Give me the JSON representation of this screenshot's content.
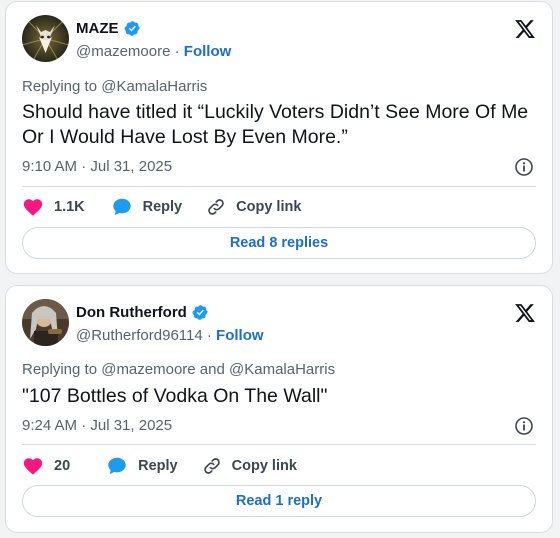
{
  "tweets": [
    {
      "name": "MAZE",
      "handle": "@mazemoore",
      "separator": "·",
      "follow_label": "Follow",
      "replying_to": "Replying to @KamalaHarris",
      "text": "Should have titled it “Luckily Voters Didn’t See More Of Me Or I Would Have Lost By Even More.”",
      "timestamp": "9:10 AM · Jul 31, 2025",
      "likes": "1.1K",
      "reply_label": "Reply",
      "copy_link_label": "Copy link",
      "read_replies_label": "Read 8 replies"
    },
    {
      "name": "Don Rutherford",
      "handle": "@Rutherford96114",
      "separator": "·",
      "follow_label": "Follow",
      "replying_to": "Replying to @mazemoore and @KamalaHarris",
      "text": "\"107 Bottles of Vodka On The Wall\"",
      "timestamp": "9:24 AM · Jul 31, 2025",
      "likes": "20",
      "reply_label": "Reply",
      "copy_link_label": "Copy link",
      "read_replies_label": "Read 1 reply"
    }
  ],
  "colors": {
    "verified_blue": "#1d9bf0",
    "heart_pink": "#f91880",
    "reply_blue": "#1d9bf0",
    "link_blue": "#1d6fc7",
    "muted_text": "#536471"
  },
  "icons": [
    "verified-badge-icon",
    "x-logo-icon",
    "info-icon",
    "heart-icon",
    "reply-bubble-icon",
    "link-icon"
  ]
}
